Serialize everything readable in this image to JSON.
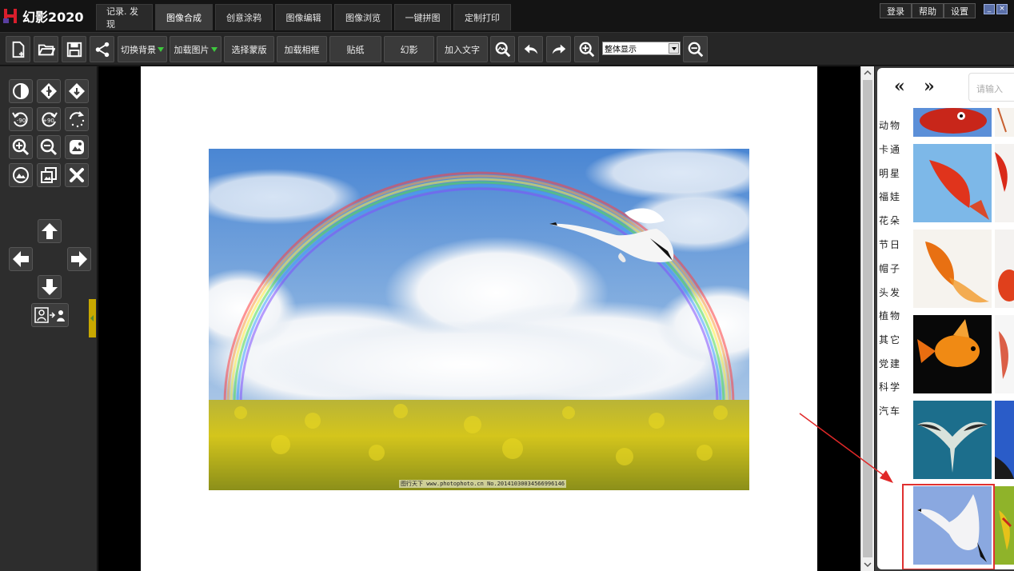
{
  "app": {
    "logo_text": "幻影2020"
  },
  "tabs": [
    {
      "label": "记录. 发现",
      "active": false
    },
    {
      "label": "图像合成",
      "active": true
    },
    {
      "label": "创意涂鸦",
      "active": false
    },
    {
      "label": "图像编辑",
      "active": false
    },
    {
      "label": "图像浏览",
      "active": false
    },
    {
      "label": "一键拼图",
      "active": false
    },
    {
      "label": "定制打印",
      "active": false
    }
  ],
  "top_right": {
    "login": "登录",
    "help": "帮助",
    "settings": "设置",
    "minimize": "_",
    "close": "×"
  },
  "toolbar": {
    "switch_bg": "切换背景",
    "load_image": "加载图片",
    "select_mask": "选择蒙版",
    "load_frame": "加载相框",
    "sticker": "贴纸",
    "phantom": "幻影",
    "add_text": "加入文字",
    "zoom_value": "整体显示"
  },
  "left_panel": {
    "rotate_minus": "-90",
    "rotate_plus": "+90"
  },
  "canvas": {
    "watermark": "图行天下 www.photophoto.cn No.20141030034566996146"
  },
  "right_panel": {
    "prev": "«",
    "next": "»",
    "search_placeholder": "请输入",
    "categories": [
      "动物",
      "卡通",
      "明星",
      "福娃",
      "花朵",
      "节日",
      "帽子",
      "头发",
      "植物",
      "其它",
      "党建",
      "科学",
      "汽车"
    ]
  },
  "colors": {
    "accent_red": "#e03030",
    "active_tab": "#3b3b3b",
    "collapse_handle": "#c8a800"
  }
}
